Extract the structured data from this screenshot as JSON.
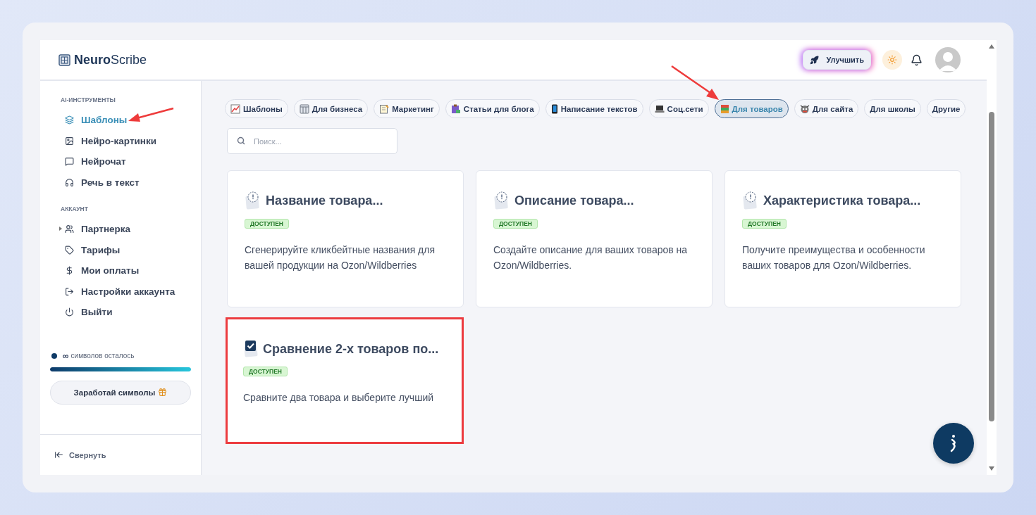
{
  "header": {
    "logo": "**Neuro**Scribe",
    "upgrade_button": "Улучшить"
  },
  "sidebar": {
    "sections": [
      {
        "title": "AI-ИНСТРУМЕНТЫ",
        "items": [
          {
            "label": "Шаблоны",
            "selected": true
          },
          {
            "label": "Нейро-картинки",
            "selected": false
          },
          {
            "label": "Нейрочат",
            "selected": false
          },
          {
            "label": "Речь в текст",
            "selected": false
          }
        ]
      },
      {
        "title": "АККАУНТ",
        "items": [
          {
            "label": "Партнерка",
            "selected": false,
            "expanded": false
          },
          {
            "label": "Тарифы",
            "selected": false
          },
          {
            "label": "Мои оплаты",
            "selected": false
          },
          {
            "label": "Настройки аккаунта",
            "selected": false
          },
          {
            "label": "Выйти",
            "selected": false
          }
        ]
      }
    ],
    "credits": {
      "amount": "∞",
      "label": "символов осталось",
      "level": 1
    },
    "earn_button": "Заработай символы",
    "collapse": "Свернуть"
  },
  "categories": [
    {
      "label": "Шаблоны",
      "selected": false
    },
    {
      "label": "Для бизнеса",
      "selected": false
    },
    {
      "label": "Маркетинг",
      "selected": false
    },
    {
      "label": "Статьи для блога",
      "selected": false
    },
    {
      "label": "Написание текстов",
      "selected": false
    },
    {
      "label": "Соц.сети",
      "selected": false
    },
    {
      "label": "Для товаров",
      "selected": true
    },
    {
      "label": "Для сайта",
      "selected": false
    },
    {
      "label": "Для школы",
      "selected": false
    },
    {
      "label": "Другие",
      "selected": false
    }
  ],
  "search": {
    "placeholder": "Поиск..."
  },
  "cards": [
    {
      "kind": "note",
      "title": "Название товара...",
      "badge": "ДОСТУПЕН",
      "description": "Сгенерируйте кликбейтные названия для вашей продукции на Ozon/Wildberries",
      "highlighted": false
    },
    {
      "kind": "note",
      "title": "Описание товара...",
      "badge": "ДОСТУПЕН",
      "description": "Создайте описание для ваших товаров на Ozon/Wildberries.",
      "highlighted": false
    },
    {
      "kind": "note",
      "title": "Характеристика товара...",
      "badge": "ДОСТУПЕН",
      "description": "Получите преимущества и особенности ваших товаров для Ozon/Wildberries.",
      "highlighted": false
    },
    {
      "kind": "checklist",
      "title": "Сравнение 2-х товаров по...",
      "badge": "ДОСТУПЕН",
      "description": "Сравните два товара и выберите лучший",
      "highlighted": true
    }
  ]
}
